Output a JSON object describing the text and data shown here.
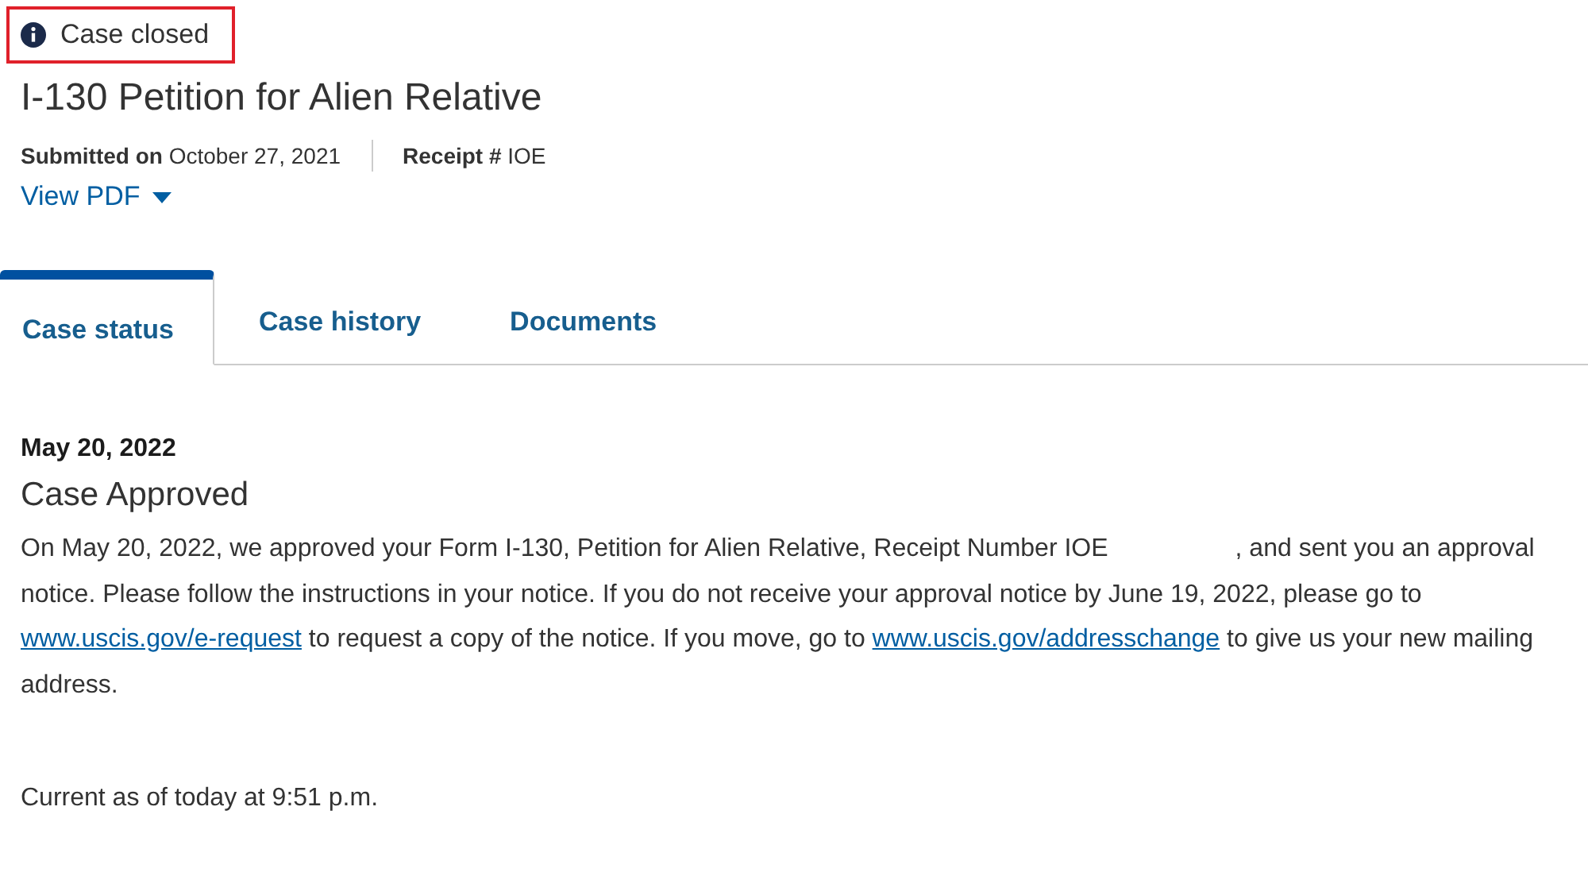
{
  "status": {
    "label": "Case closed",
    "highlighted": true
  },
  "title": "I-130 Petition for Alien Relative",
  "meta": {
    "submitted_label": "Submitted on",
    "submitted_value": "October 27, 2021",
    "receipt_label": "Receipt #",
    "receipt_value": "IOE"
  },
  "view_pdf": "View PDF",
  "tabs": [
    {
      "label": "Case status",
      "selected": true
    },
    {
      "label": "Case history",
      "selected": false
    },
    {
      "label": "Documents",
      "selected": false
    }
  ],
  "update": {
    "date": "May 20, 2022",
    "heading": "Case Approved",
    "parts": [
      {
        "kind": "text",
        "text": "On May 20, 2022, we approved your Form I-130, Petition for Alien Relative, Receipt Number IOE"
      },
      {
        "kind": "redacted"
      },
      {
        "kind": "text",
        "text": ", and sent you an approval notice. Please follow the instructions in your notice. If you do not receive your approval notice by June 19, 2022, please go to "
      },
      {
        "kind": "link",
        "text": "www.uscis.gov/e-request"
      },
      {
        "kind": "text",
        "text": " to request a copy of the notice. If you move, go to "
      },
      {
        "kind": "link",
        "text": "www.uscis.gov/addresschange"
      },
      {
        "kind": "text",
        "text": " to give us your new mailing address."
      }
    ]
  },
  "current_as_of": "Current as of today at 9:51 p.m."
}
